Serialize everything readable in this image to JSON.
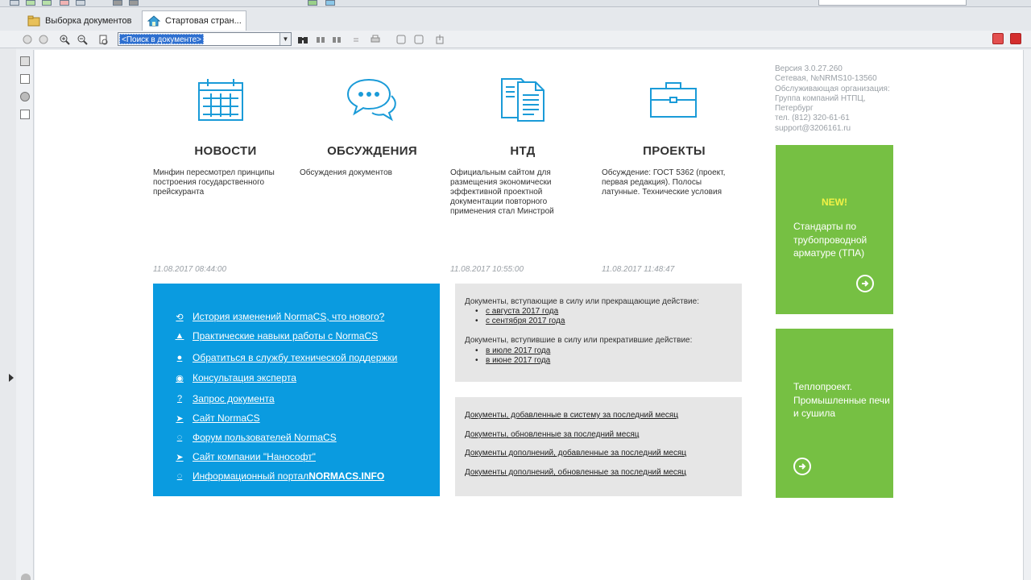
{
  "tabs": [
    {
      "label": "Выборка документов"
    },
    {
      "label": "Стартовая стран..."
    }
  ],
  "toolbar": {
    "search_value": "<Поиск в документе>"
  },
  "sections": [
    {
      "title": "НОВОСТИ",
      "text": "Минфин пересмотрел принципы построения государственного прейскуранта",
      "date": "11.08.2017 08:44:00",
      "icon": "calendar-icon"
    },
    {
      "title": "ОБСУЖДЕНИЯ",
      "text": "Обсуждения документов",
      "date": "",
      "icon": "chat-bubbles-icon"
    },
    {
      "title": "НТД",
      "text": "Официальным сайтом для размещения экономически эффективной проектной документации повторного применения стал Минстрой",
      "date": "11.08.2017 10:55:00",
      "icon": "documents-icon"
    },
    {
      "title": "ПРОЕКТЫ",
      "text": "Обсуждение: ГОСТ 5362 (проект, первая редакция). Полосы латунные. Технические условия",
      "date": "11.08.2017 11:48:47",
      "icon": "briefcase-icon"
    }
  ],
  "links": [
    {
      "label": "История изменений NormaCS, что нового?",
      "icon": "history-icon"
    },
    {
      "label": "Практические навыки работы с NormaCS",
      "icon": "graduation-cap-icon"
    },
    {
      "label": "Обратиться в службу технической поддержки",
      "icon": "user-icon"
    },
    {
      "label": "Консультация эксперта",
      "icon": "chat-icon"
    },
    {
      "label": "Запрос документа",
      "icon": "document-question-icon"
    },
    {
      "label": "Сайт NormaCS",
      "icon": "plane-icon"
    },
    {
      "label": "Форум пользователей NormaCS",
      "icon": "speech-icon"
    },
    {
      "label": "Сайт компании \"Нанософт\"",
      "icon": "plane-icon"
    },
    {
      "label_prefix": "Информационный портал ",
      "label_bold": "NORMACS.INFO",
      "icon": "speech-icon"
    }
  ],
  "effective": {
    "coming_title": "Документы, вступающие в силу или прекращающие действие:",
    "coming_items": [
      "с августа 2017 года",
      "с сентября 2017 года"
    ],
    "came_title": "Документы, вступившие в силу или прекратившие действие:",
    "came_items": [
      "в июле 2017 года",
      "в июне 2017 года"
    ]
  },
  "monthly_links": [
    "Документы, добавленные в систему за последний месяц",
    "Документы, обновленные за последний месяц",
    "Документы дополнений, добавленные за последний месяц",
    "Документы дополнений, обновленные за последний месяц"
  ],
  "version_info": [
    "Версия 3.0.27.260",
    "Сетевая, №NRMS10-13560",
    "Обслуживающая организация:",
    "Группа компаний НТПЦ,",
    "Петербург",
    "тел. (812) 320-61-61",
    "support@3206161.ru"
  ],
  "promo": [
    {
      "badge": "NEW!",
      "text": "Стандарты по трубопроводной арматуре (ТПА)"
    },
    {
      "badge": "",
      "text": "Теплопроект. Промышленные печи и сушила"
    }
  ],
  "colors": {
    "blue_panel": "#0a9be0",
    "green_panel": "#76c043",
    "grey_panel": "#e6e6e6",
    "icon_blue": "#1a9bd8",
    "new_badge": "#f2f246"
  }
}
